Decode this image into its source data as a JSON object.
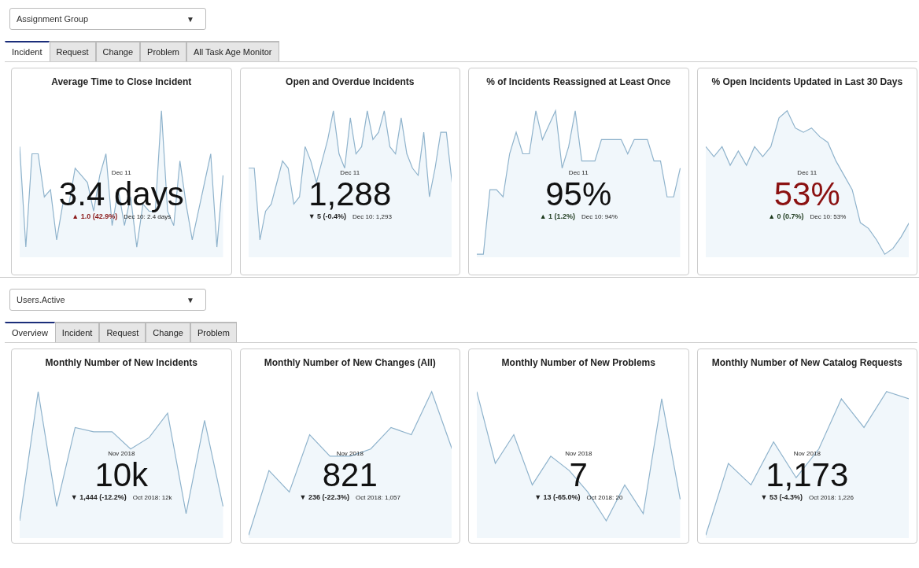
{
  "sections": [
    {
      "dropdown": {
        "value": "Assignment Group",
        "caret": "▼"
      },
      "tabs": [
        {
          "label": "Incident",
          "selected": true
        },
        {
          "label": "Request",
          "selected": false
        },
        {
          "label": "Change",
          "selected": false
        },
        {
          "label": "Problem",
          "selected": false
        },
        {
          "label": "All Task Age Monitor",
          "selected": false
        }
      ],
      "cards": [
        {
          "title": "Average Time to Close Incident",
          "date": "Dec 11",
          "value": "3.4 days",
          "color": "#111111",
          "change": {
            "text": "▲ 1.0 (42.9%)",
            "color": "#8b1a1a"
          },
          "previous": "Dec 10: 2.4 days"
        },
        {
          "title": "Open and Overdue Incidents",
          "date": "Dec 11",
          "value": "1,288",
          "color": "#111111",
          "change": {
            "text": "▼ 5 (-0.4%)",
            "color": "#222222"
          },
          "previous": "Dec 10: 1,293"
        },
        {
          "title": "% of Incidents Reassigned at Least Once",
          "date": "Dec 11",
          "value": "95%",
          "color": "#111111",
          "change": {
            "text": "▲ 1 (1.2%)",
            "color": "#1e3a1e"
          },
          "previous": "Dec 10: 94%"
        },
        {
          "title": "% Open Incidents Updated in Last 30 Days",
          "date": "Dec 11",
          "value": "53%",
          "color": "#8b1111",
          "change": {
            "text": "▲ 0 (0.7%)",
            "color": "#1e3a1e"
          },
          "previous": "Dec 10: 53%"
        }
      ]
    },
    {
      "dropdown": {
        "value": "Users.Active",
        "caret": "▼"
      },
      "tabs": [
        {
          "label": "Overview",
          "selected": true
        },
        {
          "label": "Incident",
          "selected": false
        },
        {
          "label": "Request",
          "selected": false
        },
        {
          "label": "Change",
          "selected": false
        },
        {
          "label": "Problem",
          "selected": false
        }
      ],
      "cards": [
        {
          "title": "Monthly Number of New Incidents",
          "date": "Nov 2018",
          "value": "10k",
          "color": "#111111",
          "change": {
            "text": "▼ 1,444 (-12.2%)",
            "color": "#222222"
          },
          "previous": "Oct 2018: 12k"
        },
        {
          "title": "Monthly Number of New Changes (All)",
          "date": "Nov 2018",
          "value": "821",
          "color": "#111111",
          "change": {
            "text": "▼ 236 (-22.3%)",
            "color": "#222222"
          },
          "previous": "Oct 2018: 1,057"
        },
        {
          "title": "Monthly Number of New Problems",
          "date": "Nov 2018",
          "value": "7",
          "color": "#111111",
          "change": {
            "text": "▼ 13 (-65.0%)",
            "color": "#222222"
          },
          "previous": "Oct 2018: 20"
        },
        {
          "title": "Monthly Number of New Catalog Requests",
          "date": "Nov 2018",
          "value": "1,173",
          "color": "#111111",
          "change": {
            "text": "▼ 53 (-4.3%)",
            "color": "#222222"
          },
          "previous": "Oct 2018: 1,226"
        }
      ]
    }
  ]
}
